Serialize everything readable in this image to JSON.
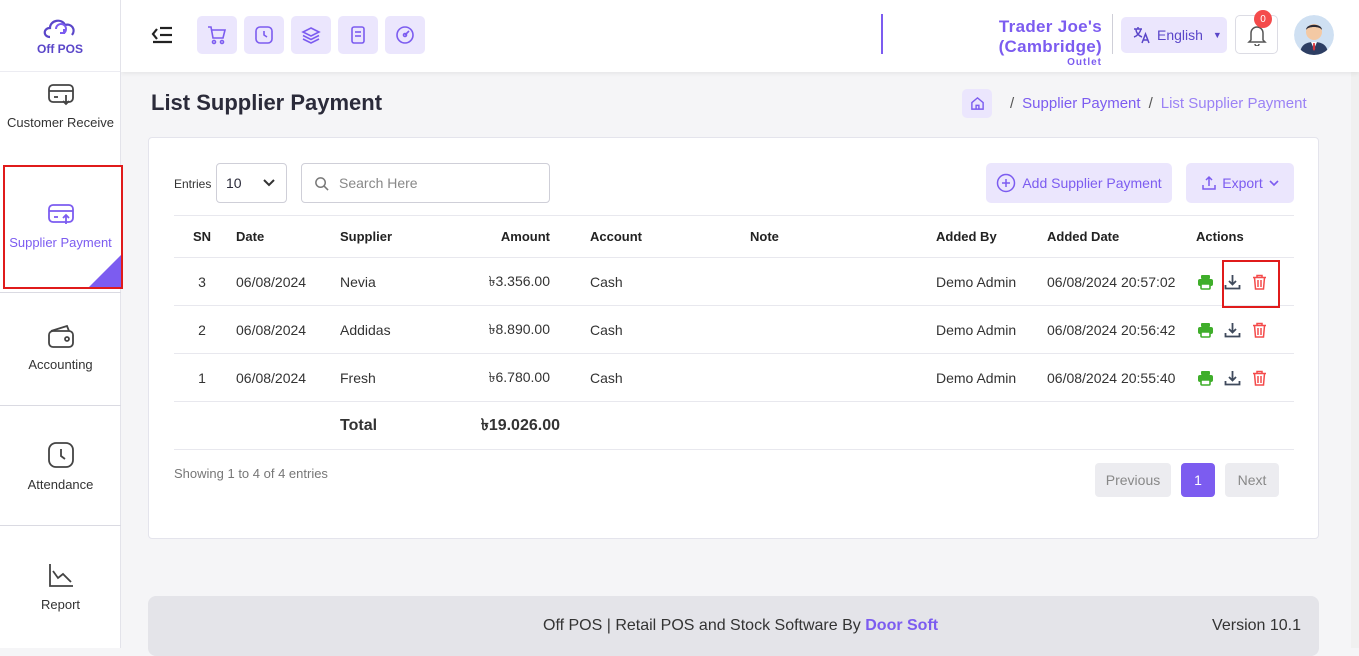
{
  "app": {
    "logo_text": "Off POS"
  },
  "sidebar": {
    "items": [
      {
        "label": "Customer Receive",
        "icon": "receive-icon"
      },
      {
        "label": "Supplier Payment",
        "icon": "payment-icon",
        "active": true
      },
      {
        "label": "Accounting",
        "icon": "wallet-icon"
      },
      {
        "label": "Attendance",
        "icon": "clock-icon"
      },
      {
        "label": "Report",
        "icon": "chart-icon"
      }
    ]
  },
  "header": {
    "outlet_name": "Trader Joe's (Cambridge)",
    "outlet_type": "Outlet",
    "language": "English",
    "notification_count": "0"
  },
  "page": {
    "title": "List Supplier Payment",
    "breadcrumb": [
      "Supplier Payment",
      "List Supplier Payment"
    ]
  },
  "toolbar": {
    "entries_label": "Entries",
    "entries_value": "10",
    "search_placeholder": "Search Here",
    "add_label": "Add Supplier Payment",
    "export_label": "Export"
  },
  "table": {
    "columns": [
      "SN",
      "Date",
      "Supplier",
      "Amount",
      "Account",
      "Note",
      "Added By",
      "Added Date",
      "Actions"
    ],
    "rows": [
      {
        "sn": "3",
        "date": "06/08/2024",
        "supplier": "Nevia",
        "amount": "৳3.356.00",
        "account": "Cash",
        "note": "",
        "added_by": "Demo Admin",
        "added_date": "06/08/2024",
        "added_time": "20:57:02"
      },
      {
        "sn": "2",
        "date": "06/08/2024",
        "supplier": "Addidas",
        "amount": "৳8.890.00",
        "account": "Cash",
        "note": "",
        "added_by": "Demo Admin",
        "added_date": "06/08/2024",
        "added_time": "20:56:42"
      },
      {
        "sn": "1",
        "date": "06/08/2024",
        "supplier": "Fresh",
        "amount": "৳6.780.00",
        "account": "Cash",
        "note": "",
        "added_by": "Demo Admin",
        "added_date": "06/08/2024",
        "added_time": "20:55:40"
      }
    ],
    "total_label": "Total",
    "total_amount": "৳19.026.00"
  },
  "pagination": {
    "info": "Showing 1 to 4 of 4 entries",
    "previous": "Previous",
    "current": "1",
    "next": "Next"
  },
  "footer": {
    "text": "Off POS | Retail POS and Stock Software By",
    "company": "Door Soft",
    "version": "Version 10.1"
  },
  "colors": {
    "accent": "#7c5cf0",
    "accent_light": "#ebe6fd",
    "print": "#3fae2a",
    "delete": "#f44b4b",
    "highlight": "#e01b1b"
  }
}
